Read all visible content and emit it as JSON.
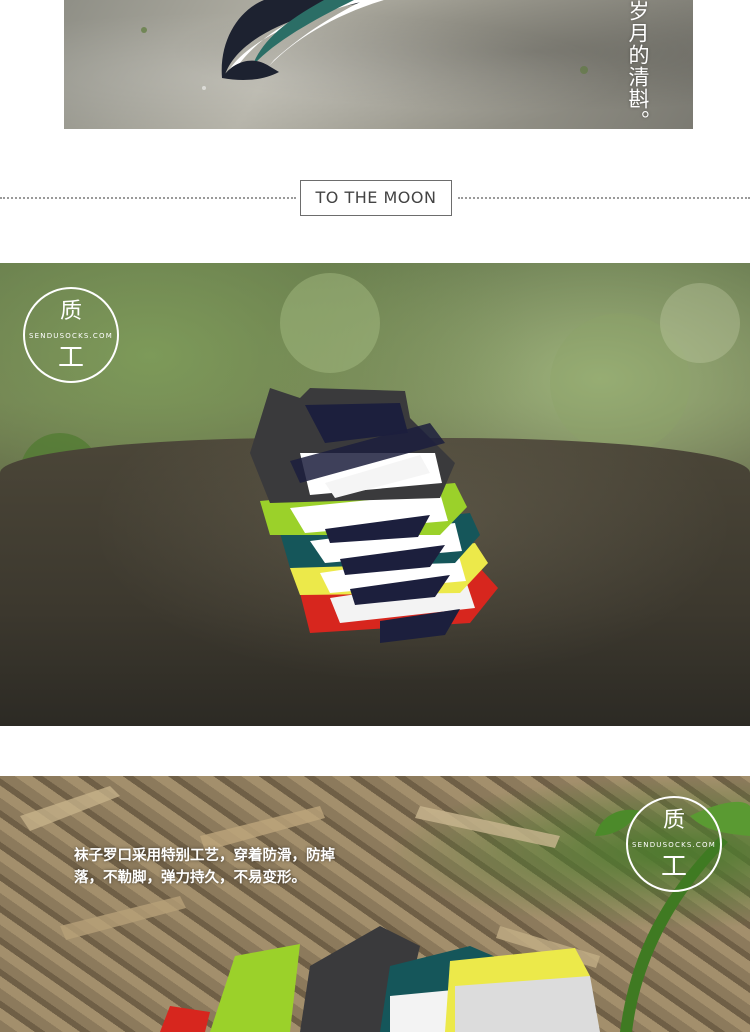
{
  "top_section": {
    "caption": "岁月的清斟。"
  },
  "divider": {
    "label": "TO THE MOON"
  },
  "logo": {
    "site": "SENDUSOCKS.COM",
    "glyph_top": "质",
    "glyph_bottom": "工"
  },
  "bottom_section": {
    "caption_line1": "袜子罗口采用特别工艺，穿着防滑，防掉",
    "caption_line2": "落，不勒脚，弹力持久，不易变形。"
  },
  "colors": {
    "page_bg": "#ffffff",
    "divider_text": "#444444",
    "sock_red": "#d7261e",
    "sock_lime": "#9bd12a",
    "sock_yellow": "#ece94a",
    "sock_teal": "#15565a",
    "sock_navy": "#1c1f3d"
  }
}
